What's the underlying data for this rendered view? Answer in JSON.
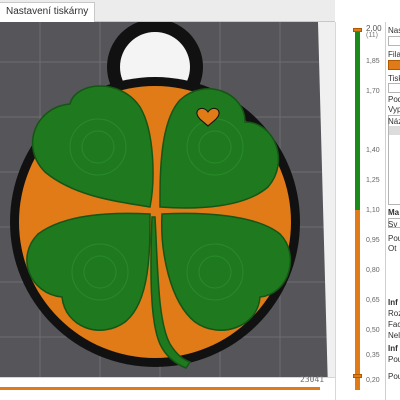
{
  "tabs": {
    "active_label": "Nastavení tiskárny"
  },
  "viewport": {
    "colors": {
      "background": "#4b4b4f",
      "bed_grid": "#6d6d72",
      "outline": "#111111",
      "infill_orange": "#e07b18",
      "clover_green": "#1f7a1f"
    }
  },
  "bottom_bar": {
    "readout": "23041",
    "icons": [
      "undo-icon",
      "lock-icon",
      "settings-icon"
    ]
  },
  "layer_slider": {
    "top_value": "2,00",
    "top_sub": "(11)",
    "ticks": [
      "2,00",
      "1,85",
      "1,70",
      "1,40",
      "1,25",
      "1,10",
      "0,95",
      "0,80",
      "0,65",
      "0,50",
      "0,35",
      "0,20"
    ],
    "colors": {
      "upper": "#1a8a1a",
      "lower": "#e07b18"
    }
  },
  "right_panel": {
    "labels": [
      "Nast",
      "Filam",
      "Tisk",
      "Pod",
      "Vypl",
      "Náz",
      "Ma",
      "Sv",
      "Pou",
      "Ot",
      "Inf",
      "Roz",
      "Fac",
      "Nel",
      "Inf",
      "Pou",
      "Pou"
    ]
  }
}
